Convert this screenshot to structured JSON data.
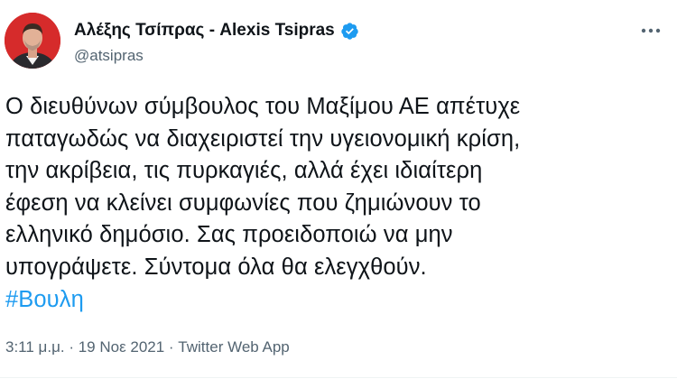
{
  "author": {
    "display_name": "Αλέξης Τσίπρας - Alexis Tsipras",
    "handle": "@atsipras",
    "verified": true,
    "avatar_icon": "avatar-photo"
  },
  "more_icon": "more-options-icon",
  "tweet": {
    "lines": [
      "Ο διευθύνων σύμβουλος του Μαξίμου ΑΕ απέτυχε",
      "παταγωδώς να διαχειριστεί την υγειονομική κρίση,",
      "την ακρίβεια, τις πυρκαγιές, αλλά έχει ιδιαίτερη",
      "έφεση να κλείνει συμφωνίες που ζημιώνουν το",
      "ελληνικό δημόσιο. Σας προειδοποιώ να μην",
      "υπογράψετε. Σύντομα όλα θα ελεγχθούν."
    ],
    "hashtag": "#Βουλη"
  },
  "meta": {
    "time": "3:11 μ.μ.",
    "separator": " · ",
    "date": "19 Νοε 2021",
    "source": "Twitter Web App"
  },
  "colors": {
    "link": "#1d9bf0",
    "secondary_text": "#536471",
    "primary_text": "#0f1419",
    "verified_badge": "#1d9bf0",
    "avatar_bg": "#d62b2b"
  }
}
